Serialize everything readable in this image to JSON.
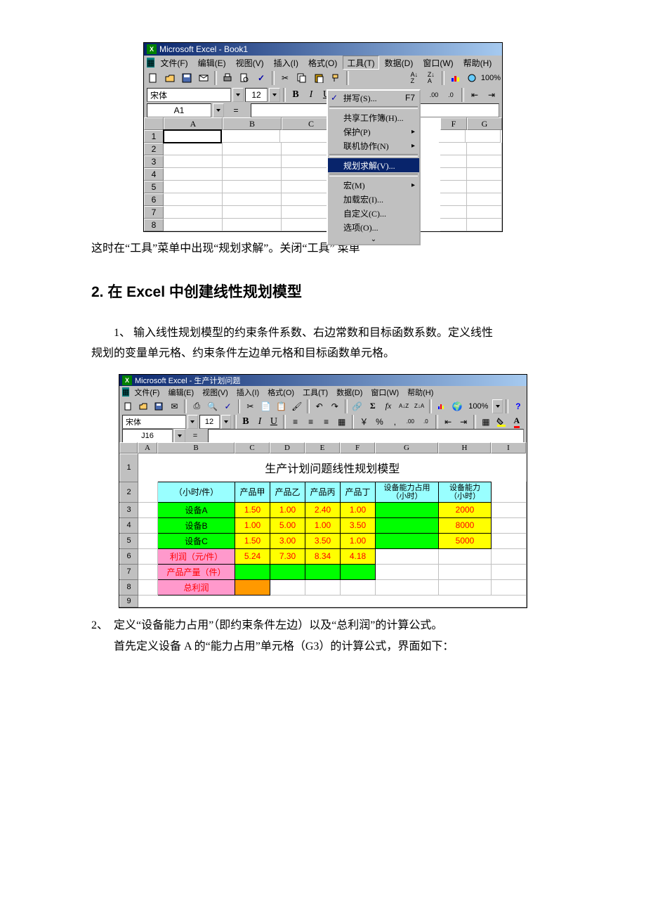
{
  "ss1": {
    "title": "Microsoft Excel - Book1",
    "menus": [
      "文件(F)",
      "编辑(E)",
      "视图(V)",
      "插入(I)",
      "格式(O)",
      "工具(T)",
      "数据(D)",
      "窗口(W)",
      "帮助(H)"
    ],
    "font": "宋体",
    "fontSize": "12",
    "nameBox": "A1",
    "zoom": "100%",
    "f7": "F7",
    "cols": [
      "A",
      "B",
      "C",
      "F",
      "G"
    ],
    "rows": [
      "1",
      "2",
      "3",
      "4",
      "5",
      "6",
      "7",
      "8"
    ],
    "menu": {
      "spell": "拼写(S)...",
      "share": "共享工作簿(H)...",
      "protect": "保护(P)",
      "online": "联机协作(N)",
      "solver": "规划求解(V)...",
      "macro": "宏(M)",
      "addin": "加载宏(I)...",
      "custom": "自定义(C)...",
      "options": "选项(O)..."
    }
  },
  "text1": "这时在“工具”菜单中出现“规划求解”。关闭“工具” 菜单",
  "heading": "2.  在 Excel 中创建线性规划模型",
  "step1a": "1、 输入线性规划模型的约束条件系数、右边常数和目标函数系数。定义线性",
  "step1b": "规划的变量单元格、约束条件左边单元格和目标函数单元格。",
  "ss2": {
    "title": "Microsoft Excel - 生产计划问题",
    "menus": [
      "文件(F)",
      "编辑(E)",
      "视图(V)",
      "插入(I)",
      "格式(O)",
      "工具(T)",
      "数据(D)",
      "窗口(W)",
      "帮助(H)"
    ],
    "font": "宋体",
    "fontSize": "12",
    "nameBox": "J16",
    "zoom": "100%",
    "cols": [
      "A",
      "B",
      "C",
      "D",
      "E",
      "F",
      "G",
      "H",
      "I"
    ],
    "rows": [
      "1",
      "2",
      "3",
      "4",
      "5",
      "6",
      "7",
      "8",
      "9"
    ],
    "sheetTitle": "生产计划问题线性规划模型",
    "h": {
      "hr": "（小时/件）",
      "p1": "产品甲",
      "p2": "产品乙",
      "p3": "产品丙",
      "p4": "产品丁",
      "used": "设备能力占用（小时）",
      "cap": "设备能力（小时）"
    },
    "r3": {
      "b": "设备A",
      "c": "1.50",
      "d": "1.00",
      "e": "2.40",
      "f": "1.00",
      "h": "2000"
    },
    "r4": {
      "b": "设备B",
      "c": "1.00",
      "d": "5.00",
      "e": "1.00",
      "f": "3.50",
      "h": "8000"
    },
    "r5": {
      "b": "设备C",
      "c": "1.50",
      "d": "3.00",
      "e": "3.50",
      "f": "1.00",
      "h": "5000"
    },
    "r6": {
      "b": "利润（元/件）",
      "c": "5.24",
      "d": "7.30",
      "e": "8.34",
      "f": "4.18"
    },
    "r7": {
      "b": "产品产量（件）"
    },
    "r8": {
      "b": "总利润"
    }
  },
  "step2a": "定义“设备能力占用”（即约束条件左边）以及“总利润”的计算公式。",
  "step2b": "首先定义设备 A 的“能力占用”单元格（G3）的计算公式，界面如下：",
  "step2num": "2、"
}
